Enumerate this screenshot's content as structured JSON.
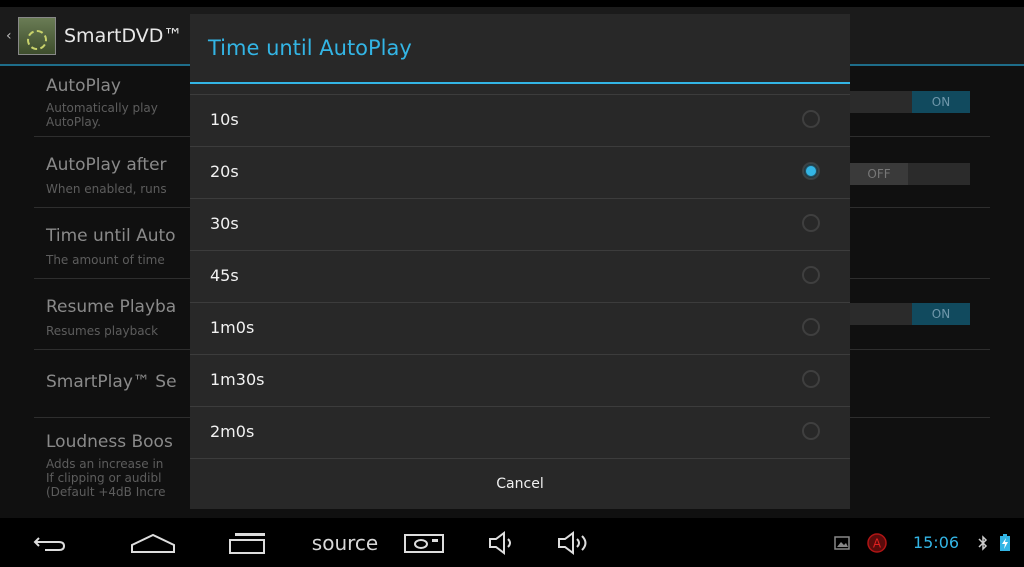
{
  "app": {
    "title": "SmartDVD™"
  },
  "settings": [
    {
      "title": "AutoPlay",
      "summary": [
        "Automatically play",
        "AutoPlay."
      ],
      "toggle": "ON"
    },
    {
      "title": "AutoPlay after",
      "summary": [
        "When enabled, runs"
      ],
      "toggle": "OFF"
    },
    {
      "title": "Time until Auto",
      "summary": [
        "The amount of time"
      ]
    },
    {
      "title": "Resume Playba",
      "summary": [
        "Resumes playback"
      ],
      "toggle": "ON"
    },
    {
      "title": "SmartPlay™ Se",
      "summary": []
    },
    {
      "title": "Loudness Boos",
      "summary": [
        "Adds an increase in",
        "If clipping or audibl",
        "(Default +4dB Incre"
      ]
    }
  ],
  "dialog": {
    "title": "Time until AutoPlay",
    "options": [
      {
        "label": "10s",
        "checked": false
      },
      {
        "label": "20s",
        "checked": true
      },
      {
        "label": "30s",
        "checked": false
      },
      {
        "label": "45s",
        "checked": false
      },
      {
        "label": "1m0s",
        "checked": false
      },
      {
        "label": "1m30s",
        "checked": false
      },
      {
        "label": "2m0s",
        "checked": false
      }
    ],
    "cancel_label": "Cancel"
  },
  "navbar": {
    "source_label": "source",
    "clock": "15:06"
  },
  "colors": {
    "accent": "#33b5e5",
    "dialog_bg": "#282828"
  }
}
